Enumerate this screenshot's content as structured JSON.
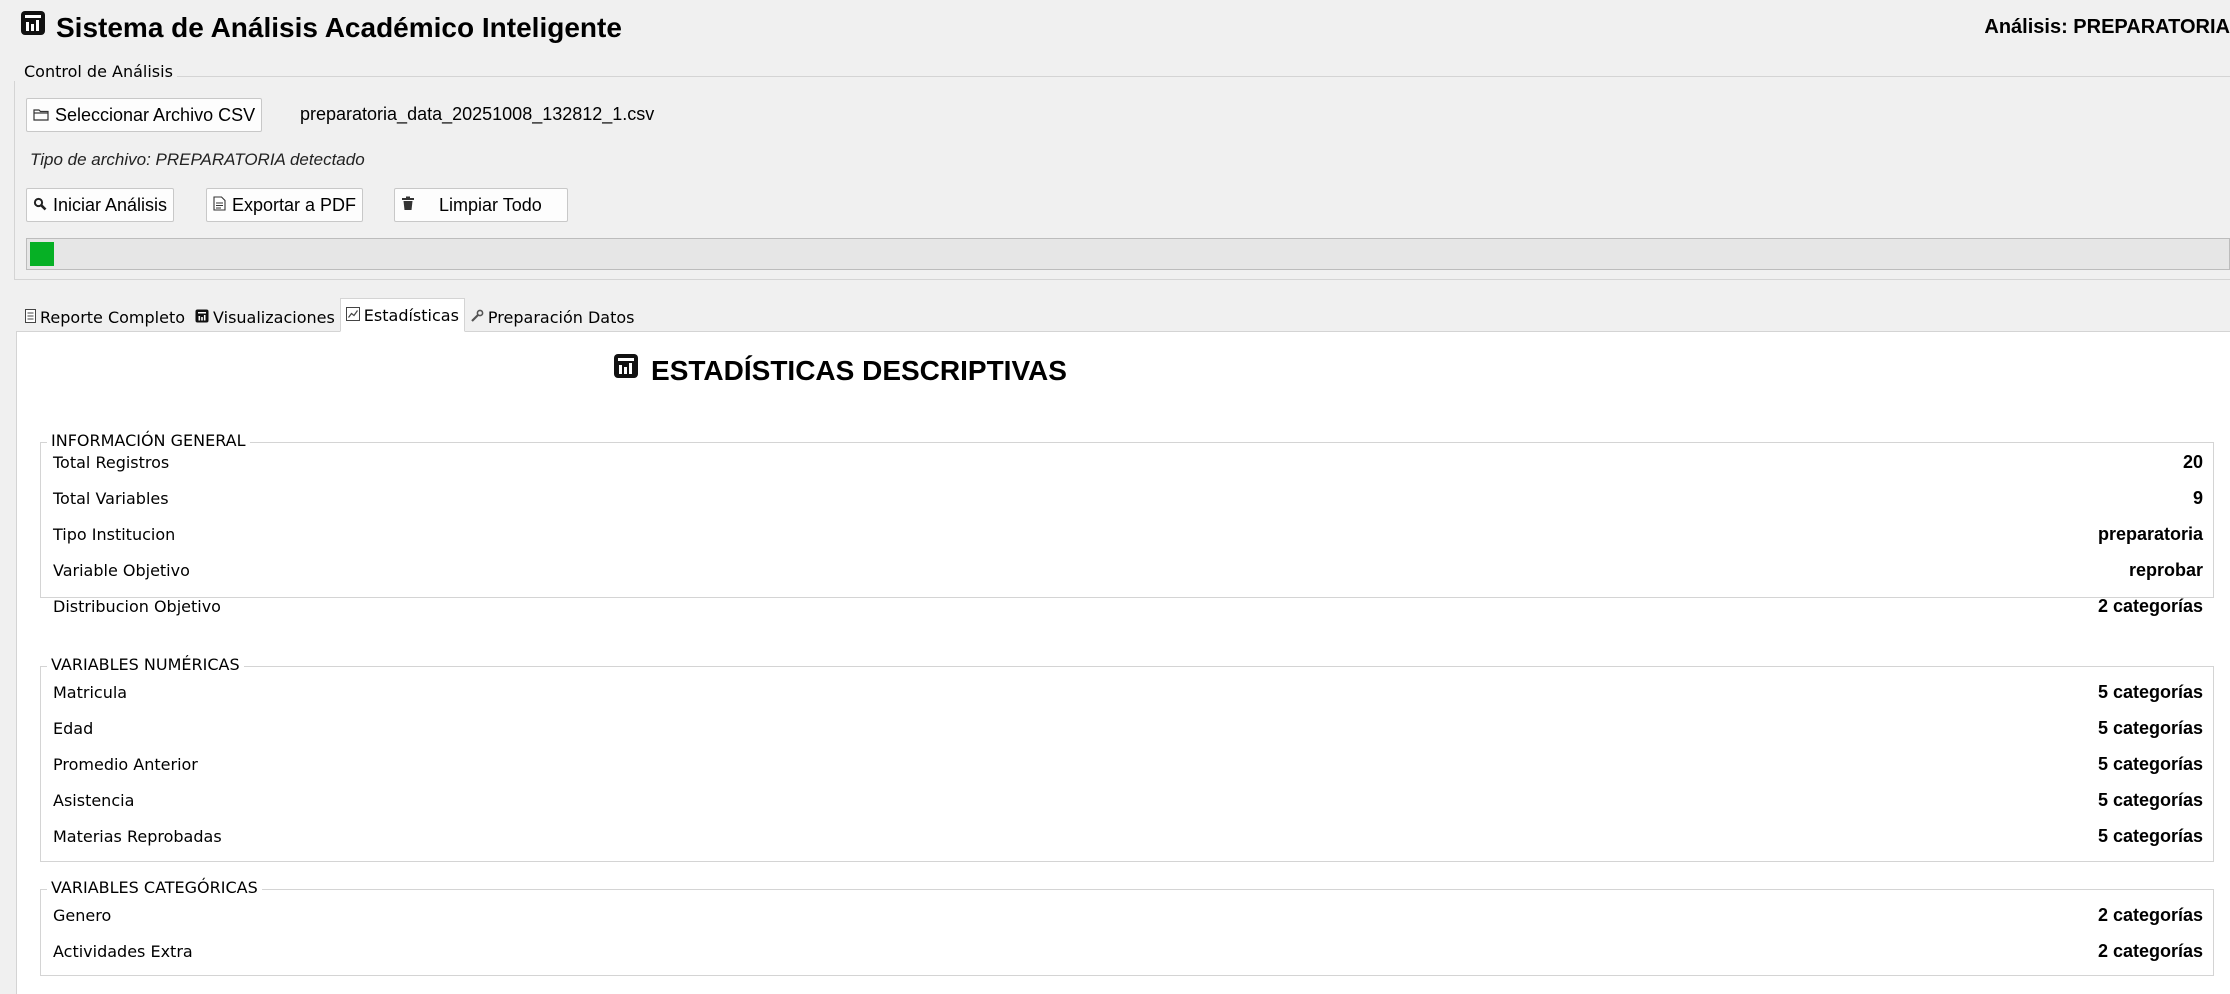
{
  "header": {
    "title": "Sistema de Análisis Académico Inteligente",
    "title_icon": "chart-icon",
    "analysis_label": "Análisis: PREPARATORIA"
  },
  "control": {
    "legend": "Control de Análisis",
    "select_csv_label": "Seleccionar Archivo CSV",
    "select_csv_icon": "folder-icon",
    "file_name": "preparatoria_data_20251008_132812_1.csv",
    "file_type_text": "Tipo de archivo: PREPARATORIA detectado",
    "start_label": "Iniciar Análisis",
    "start_icon": "magnifier-icon",
    "export_label": "Exportar a PDF",
    "export_icon": "document-icon",
    "clear_label": "Limpiar Todo",
    "clear_icon": "trash-icon",
    "progress_fraction": 0.011,
    "progress_color": "#06b025"
  },
  "tabs": [
    {
      "label": "Reporte Completo",
      "icon": "report-icon",
      "active": false
    },
    {
      "label": "Visualizaciones",
      "icon": "chart-icon",
      "active": false
    },
    {
      "label": "Estadísticas",
      "icon": "line-chart-icon",
      "active": true
    },
    {
      "label": "Preparación Datos",
      "icon": "wrench-icon",
      "active": false
    }
  ],
  "stats": {
    "title": "ESTADÍSTICAS DESCRIPTIVAS",
    "groups": [
      {
        "legend": "INFORMACIÓN GENERAL",
        "rows": [
          {
            "label": "Total Registros",
            "value": "20"
          },
          {
            "label": "Total Variables",
            "value": "9"
          },
          {
            "label": "Tipo Institucion",
            "value": "preparatoria"
          },
          {
            "label": "Variable Objetivo",
            "value": "reprobar"
          },
          {
            "label": "Distribucion Objetivo",
            "value": "2 categorías"
          }
        ]
      },
      {
        "legend": "VARIABLES NUMÉRICAS",
        "rows": [
          {
            "label": "Matricula",
            "value": "5 categorías"
          },
          {
            "label": "Edad",
            "value": "5 categorías"
          },
          {
            "label": "Promedio Anterior",
            "value": "5 categorías"
          },
          {
            "label": "Asistencia",
            "value": "5 categorías"
          },
          {
            "label": "Materias Reprobadas",
            "value": "5 categorías"
          }
        ]
      },
      {
        "legend": "VARIABLES CATEGÓRICAS",
        "rows": [
          {
            "label": "Genero",
            "value": "2 categorías"
          },
          {
            "label": "Actividades Extra",
            "value": "2 categorías"
          }
        ]
      }
    ]
  }
}
